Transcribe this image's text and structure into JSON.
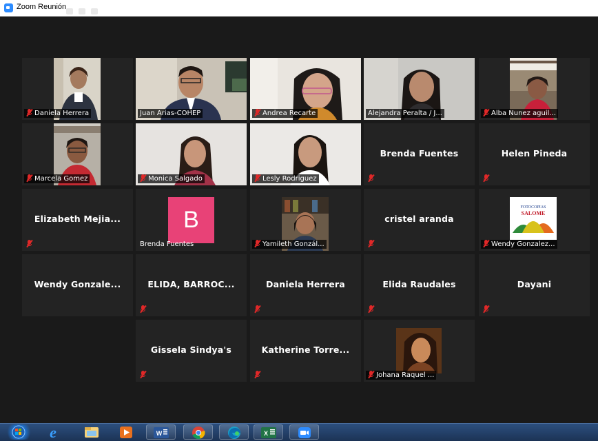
{
  "window": {
    "title": "Zoom Reunión"
  },
  "colors": {
    "stage_bg": "#1a1a1a",
    "tile_bg": "#232323",
    "active_speaker_border": "#b8d84e",
    "muted_icon": "#e02828",
    "avatar_b_bg": "#e84277"
  },
  "participants": [
    {
      "name": "Daniela Herrera",
      "muted": true,
      "video": true
    },
    {
      "name": "Juan Arias-COHEP",
      "muted": false,
      "video": true
    },
    {
      "name": "Andrea Recarte",
      "muted": true,
      "video": true
    },
    {
      "name": "Alejandra Peralta / J...",
      "muted": false,
      "video": true,
      "active_speaker": true
    },
    {
      "name": "Alba Nunez aguil...",
      "muted": true,
      "video": true
    },
    {
      "name": "Marcela Gomez",
      "muted": true,
      "video": true
    },
    {
      "name": "Monica Salgado",
      "muted": true,
      "video": true
    },
    {
      "name": "Lesly Rodriguez",
      "muted": true,
      "video": true
    },
    {
      "name": "Brenda Fuentes",
      "muted": true,
      "video": false
    },
    {
      "name": "Helen Pineda",
      "muted": true,
      "video": false
    },
    {
      "name": "Elizabeth  Mejia...",
      "muted": true,
      "video": false
    },
    {
      "name": "Brenda Fuentes",
      "muted": false,
      "video": false,
      "avatar_letter": "B"
    },
    {
      "name": "Yamileth Gonzál...",
      "muted": true,
      "video": true
    },
    {
      "name": "cristel aranda",
      "muted": true,
      "video": false
    },
    {
      "name": "Wendy Gonzalez...",
      "muted": true,
      "video": true,
      "logo_text": [
        "FOTOCOPIAS",
        "SALOME"
      ]
    },
    {
      "name": "Wendy  Gonzale...",
      "muted": false,
      "video": false
    },
    {
      "name": "ELIDA, BARROC...",
      "muted": true,
      "video": false
    },
    {
      "name": "Daniela Herrera",
      "muted": true,
      "video": false
    },
    {
      "name": "Elida Raudales",
      "muted": true,
      "video": false
    },
    {
      "name": "Dayani",
      "muted": true,
      "video": false
    },
    {
      "name": "Gissela Sindya's",
      "muted": true,
      "video": false
    },
    {
      "name": "Katherine  Torre...",
      "muted": true,
      "video": false
    },
    {
      "name": "Johana Raquel ...",
      "muted": true,
      "video": true
    }
  ],
  "taskbar": {
    "items": [
      {
        "icon": "windows-start-icon"
      },
      {
        "icon": "internet-explorer-icon"
      },
      {
        "icon": "file-explorer-icon"
      },
      {
        "icon": "media-player-icon"
      },
      {
        "icon": "word-icon"
      },
      {
        "icon": "chrome-icon"
      },
      {
        "icon": "edge-icon"
      },
      {
        "icon": "excel-icon"
      },
      {
        "icon": "zoom-icon"
      }
    ]
  }
}
